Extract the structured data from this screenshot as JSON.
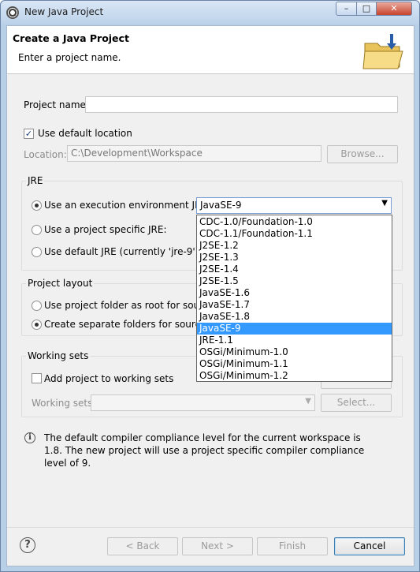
{
  "window": {
    "title": "New Java Project",
    "controls": [
      "–",
      "□",
      "✕"
    ]
  },
  "banner": {
    "title": "Create a Java Project",
    "subtitle": "Enter a project name.",
    "icon": "java-folder-icon"
  },
  "project_name": {
    "label": "Project name:",
    "value": ""
  },
  "location": {
    "use_default_label": "Use default location",
    "use_default_checked": true,
    "label": "Location:",
    "value": "C:\\Development\\Workspace",
    "browse_label": "Browse..."
  },
  "jre": {
    "group_title": "JRE",
    "option_execution_env": "Use an execution environment JRE:",
    "option_project_specific": "Use a project specific JRE:",
    "option_default": "Use default JRE (currently 'jre-9')",
    "selected_option": "execution_env",
    "combo_value": "JavaSE-9",
    "dropdown_options": [
      "CDC-1.0/Foundation-1.0",
      "CDC-1.1/Foundation-1.1",
      "J2SE-1.2",
      "J2SE-1.3",
      "J2SE-1.4",
      "J2SE-1.5",
      "JavaSE-1.6",
      "JavaSE-1.7",
      "JavaSE-1.8",
      "JavaSE-9",
      "JRE-1.1",
      "OSGi/Minimum-1.0",
      "OSGi/Minimum-1.1",
      "OSGi/Minimum-1.2"
    ],
    "selected_dropdown_option": "JavaSE-9"
  },
  "project_layout": {
    "group_title": "Project layout",
    "option_root": "Use project folder as root for sources",
    "option_separate": "Create separate folders for sources ar",
    "selected_option": "separate"
  },
  "working_sets": {
    "group_title": "Working sets",
    "add_label": "Add project to working sets",
    "add_checked": false,
    "sets_label": "Working sets:",
    "select_label": "Select..."
  },
  "info": {
    "text": "The default compiler compliance level for the current workspace is 1.8. The new project will use a project specific compiler compliance level of 9."
  },
  "footer": {
    "back_label": "< Back",
    "next_label": "Next >",
    "finish_label": "Finish",
    "cancel_label": "Cancel"
  },
  "colors": {
    "selection": "#3399ff",
    "accent_border": "#3c7fb1",
    "titlebar": "#bcd2ea"
  }
}
